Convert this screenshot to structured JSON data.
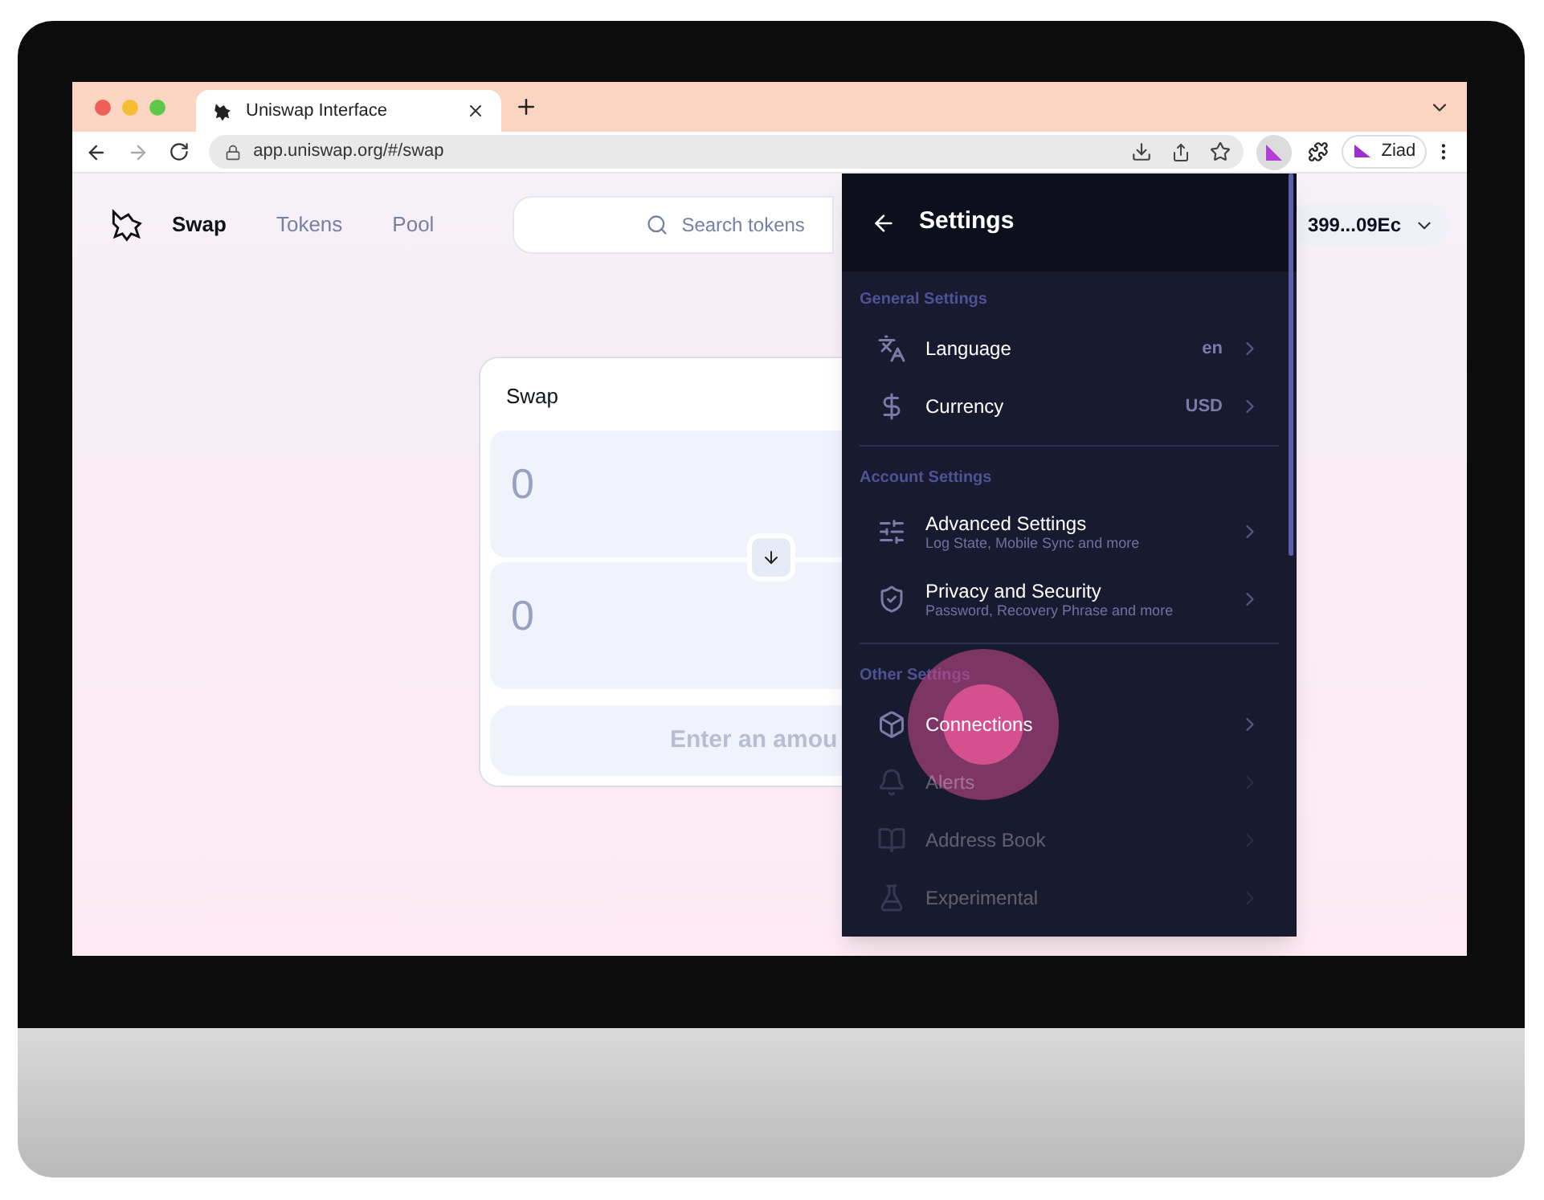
{
  "browser": {
    "tab": {
      "title": "Uniswap Interface"
    },
    "url": "app.uniswap.org/#/swap",
    "profile": "Ziad"
  },
  "page": {
    "nav": [
      {
        "label": "Swap",
        "selected": true
      },
      {
        "label": "Tokens",
        "selected": false
      },
      {
        "label": "Pool",
        "selected": false
      }
    ],
    "search": {
      "placeholder": "Search tokens"
    },
    "wallet": "399...09Ec",
    "swap_card": {
      "title": "Swap",
      "inputs": [
        {
          "value": "0"
        },
        {
          "value": "0"
        }
      ],
      "button": "Enter an amou"
    }
  },
  "settings": {
    "title": "Settings",
    "sections": [
      {
        "title": "General Settings",
        "items": [
          {
            "label": "Language",
            "value": "en",
            "faded": false,
            "pressed": false
          },
          {
            "label": "Currency",
            "value": "USD",
            "faded": false,
            "pressed": false
          }
        ]
      },
      {
        "title": "Account Settings",
        "items": [
          {
            "label": "Advanced Settings",
            "subtitle": "Log State, Mobile Sync and more",
            "faded": false,
            "pressed": false
          },
          {
            "label": "Privacy and Security",
            "subtitle": "Password, Recovery Phrase and more",
            "faded": false,
            "pressed": false
          }
        ]
      },
      {
        "title": "Other Settings",
        "items": [
          {
            "label": "Connections",
            "faded": false,
            "pressed": true
          },
          {
            "label": "Alerts",
            "faded": true,
            "pressed": false
          },
          {
            "label": "Address Book",
            "faded": true,
            "pressed": false
          },
          {
            "label": "Experimental",
            "faded": true,
            "pressed": false
          }
        ]
      }
    ]
  }
}
